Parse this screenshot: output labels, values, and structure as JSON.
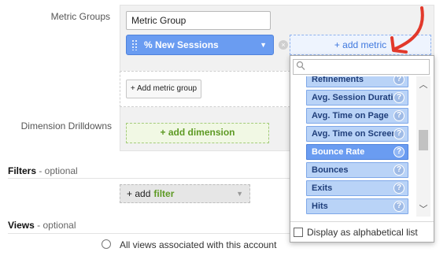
{
  "labels": {
    "metric_groups": "Metric Groups",
    "dimension_drilldowns": "Dimension Drilldowns"
  },
  "metric_group": {
    "name_value": "Metric Group",
    "metric_pill_label": "% New Sessions",
    "add_metric_label": "+ add metric",
    "add_metric_group_label": "+ Add metric group"
  },
  "dimension": {
    "add_dimension_label": "+ add dimension"
  },
  "filters": {
    "title": "Filters",
    "optional": " - optional",
    "add_prefix": "+ add",
    "add_word": "filter"
  },
  "views": {
    "title": "Views",
    "optional": " - optional",
    "radio_label": "All views associated with this account"
  },
  "dropdown": {
    "search_placeholder": "",
    "items": [
      {
        "label": "Refinements",
        "selected": false
      },
      {
        "label": "Avg. Session Duration",
        "selected": false
      },
      {
        "label": "Avg. Time on Page",
        "selected": false
      },
      {
        "label": "Avg. Time on Screen",
        "selected": false
      },
      {
        "label": "Bounce Rate",
        "selected": true
      },
      {
        "label": "Bounces",
        "selected": false
      },
      {
        "label": "Exits",
        "selected": false
      },
      {
        "label": "Hits",
        "selected": false
      }
    ],
    "help_glyph": "?",
    "footer_label": "Display as alphabetical list"
  },
  "colors": {
    "metric_blue": "#6a9cf1",
    "item_blue_light": "#b9d3f7",
    "dimension_green": "#5e9a24",
    "annotation_red": "#e2392b"
  },
  "icons": {
    "search": "search-icon",
    "scroll_up": "chevron-up-icon",
    "scroll_down": "chevron-down-icon",
    "remove": "close-icon",
    "annotation": "curved-arrow-icon"
  }
}
